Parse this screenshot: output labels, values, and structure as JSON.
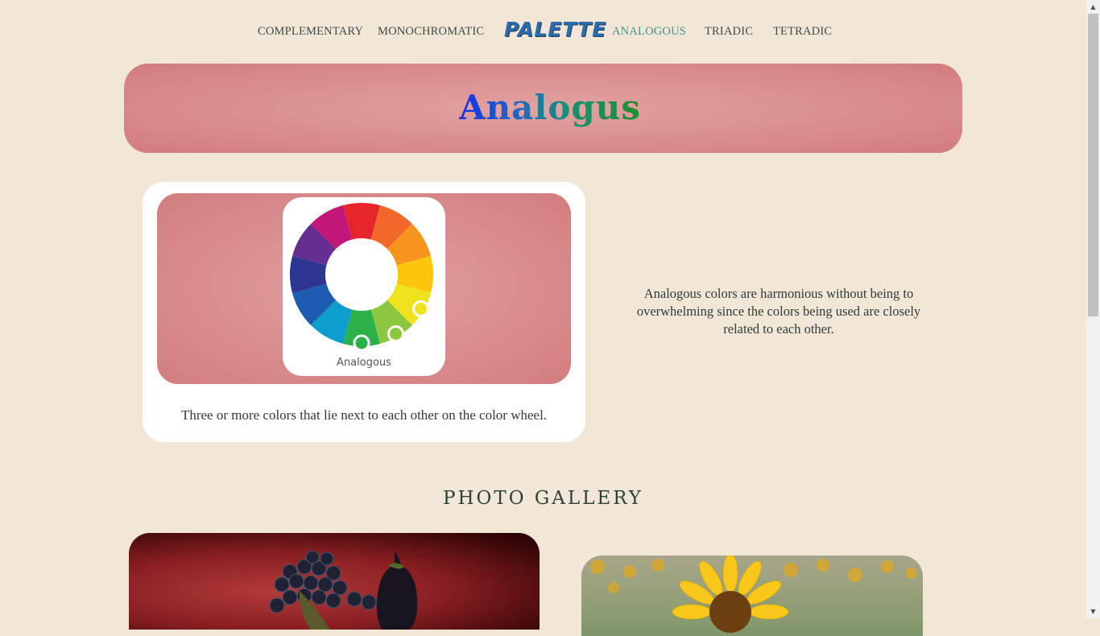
{
  "nav": {
    "links": [
      "COMPLEMENTARY",
      "MONOCHROMATIC",
      "ANALOGOUS",
      "TRIADIC",
      "TETRADIC"
    ],
    "logo": "PALETTE",
    "active": "ANALOGOUS"
  },
  "hero": {
    "title": "Analogus"
  },
  "card": {
    "wheel_label": "Analogous",
    "caption": "Three or more colors that lie next to each other on the color wheel."
  },
  "description": "Analogous colors are harmonious without being to overwhelming since the colors being used are closely related to each other.",
  "gallery": {
    "title": "PHOTO GALLERY"
  },
  "colors": {
    "background": "#f2e7d7",
    "accent": "#4a8f8c",
    "hero_pink": "#d98e8e",
    "wheel": [
      "#e6252b",
      "#f2672a",
      "#f7941d",
      "#fcc60d",
      "#eee31c",
      "#8dc63f",
      "#2bb04a",
      "#0e9dcd",
      "#1c5db1",
      "#2e3491",
      "#662e91",
      "#c2187a"
    ],
    "markers": [
      "#eee31c",
      "#8dc63f",
      "#2bb04a"
    ]
  }
}
